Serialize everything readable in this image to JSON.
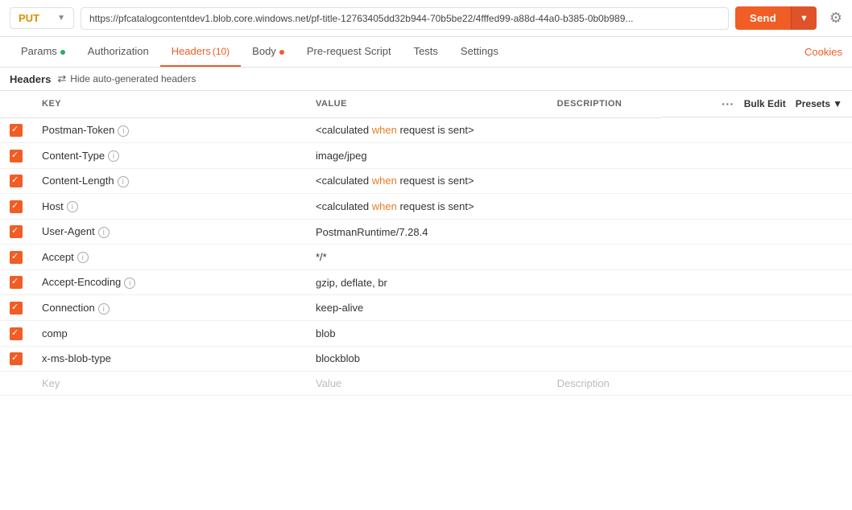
{
  "method": {
    "label": "PUT",
    "arrow": "▼"
  },
  "url": "https://pfcatalogcontentdev1.blob.core.windows.net/pf-title-12763405dd32b944-70b5be22/4fffed99-a88d-44a0-b385-0b0b989...",
  "send_button": "Send",
  "settings_icon": "⚙",
  "tabs": [
    {
      "id": "params",
      "label": "Params",
      "dot": "green",
      "active": false
    },
    {
      "id": "authorization",
      "label": "Authorization",
      "active": false
    },
    {
      "id": "headers",
      "label": "Headers",
      "count": "(10)",
      "active": true
    },
    {
      "id": "body",
      "label": "Body",
      "dot": "orange",
      "active": false
    },
    {
      "id": "prerequest",
      "label": "Pre-request Script",
      "active": false
    },
    {
      "id": "tests",
      "label": "Tests",
      "active": false
    },
    {
      "id": "settings",
      "label": "Settings",
      "active": false
    }
  ],
  "cookies_label": "Cookies",
  "sub_header": {
    "title": "Headers",
    "hide_btn_icon": "🔀",
    "hide_btn_label": "Hide auto-generated headers"
  },
  "table": {
    "columns": {
      "key": "KEY",
      "value": "VALUE",
      "description": "DESCRIPTION",
      "bulk_edit": "Bulk Edit",
      "presets": "Presets"
    },
    "rows": [
      {
        "checked": true,
        "disabled": false,
        "key": "Postman-Token",
        "has_info": true,
        "value_calc": true,
        "value": "<calculated when request is sent>",
        "description": ""
      },
      {
        "checked": true,
        "disabled": false,
        "key": "Content-Type",
        "has_info": true,
        "value_calc": false,
        "value": "image/jpeg",
        "description": ""
      },
      {
        "checked": true,
        "disabled": false,
        "key": "Content-Length",
        "has_info": true,
        "value_calc": true,
        "value": "<calculated when request is sent>",
        "description": ""
      },
      {
        "checked": true,
        "disabled": false,
        "key": "Host",
        "has_info": true,
        "value_calc": true,
        "value": "<calculated when request is sent>",
        "description": ""
      },
      {
        "checked": true,
        "disabled": false,
        "key": "User-Agent",
        "has_info": true,
        "value_calc": false,
        "value": "PostmanRuntime/7.28.4",
        "description": ""
      },
      {
        "checked": true,
        "disabled": false,
        "key": "Accept",
        "has_info": true,
        "value_calc": false,
        "value": "*/*",
        "description": ""
      },
      {
        "checked": true,
        "disabled": false,
        "key": "Accept-Encoding",
        "has_info": true,
        "value_calc": false,
        "value": "gzip, deflate, br",
        "description": ""
      },
      {
        "checked": true,
        "disabled": false,
        "key": "Connection",
        "has_info": true,
        "value_calc": false,
        "value": "keep-alive",
        "description": ""
      },
      {
        "checked": true,
        "disabled": false,
        "key": "comp",
        "has_info": false,
        "value_calc": false,
        "value": "blob",
        "description": ""
      },
      {
        "checked": true,
        "disabled": false,
        "key": "x-ms-blob-type",
        "has_info": false,
        "value_calc": false,
        "value": "blockblob",
        "description": ""
      }
    ],
    "placeholder": {
      "key": "Key",
      "value": "Value",
      "description": "Description"
    }
  }
}
